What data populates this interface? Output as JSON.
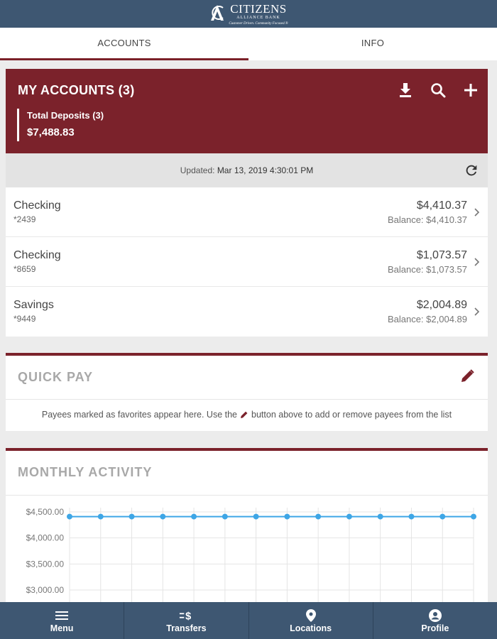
{
  "header": {
    "brand_name": "CITIZENS",
    "brand_sub": "ALLIANCE BANK",
    "brand_tagline": "Customer Driven. Community Focused.®"
  },
  "tabs": [
    {
      "label": "ACCOUNTS",
      "active": true
    },
    {
      "label": "INFO",
      "active": false
    }
  ],
  "accounts_panel": {
    "title": "MY ACCOUNTS (3)",
    "icons": [
      "download-icon",
      "search-icon",
      "add-icon"
    ],
    "total_label": "Total Deposits (3)",
    "total_value": "$7,488.83",
    "updated_prefix": "Updated:",
    "updated_value": "Mar 13, 2019 4:30:01 PM",
    "accounts": [
      {
        "name": "Checking",
        "number": "*2439",
        "amount": "$4,410.37",
        "balance": "Balance: $4,410.37"
      },
      {
        "name": "Checking",
        "number": "*8659",
        "amount": "$1,073.57",
        "balance": "Balance: $1,073.57"
      },
      {
        "name": "Savings",
        "number": "*9449",
        "amount": "$2,004.89",
        "balance": "Balance: $2,004.89"
      }
    ]
  },
  "quick_pay": {
    "title": "QUICK PAY",
    "note_before": "Payees marked as favorites appear here. Use the",
    "note_after": "button above to add or remove payees from the list"
  },
  "monthly_activity": {
    "title": "MONTHLY ACTIVITY"
  },
  "chart_data": {
    "type": "line",
    "y_ticks": [
      "$4,500.00",
      "$4,000.00",
      "$3,500.00",
      "$3,000.00"
    ],
    "y_tick_values": [
      4500,
      4000,
      3500,
      3000
    ],
    "series": [
      {
        "values": [
          4410,
          4410,
          4410,
          4410,
          4410,
          4410,
          4410,
          4410,
          4410,
          4410,
          4410,
          4410,
          4410,
          4410
        ]
      }
    ],
    "line_color": "#3ea6e6",
    "grid": true
  },
  "bottom_nav": [
    {
      "label": "Menu",
      "icon": "menu-icon"
    },
    {
      "label": "Transfers",
      "icon": "transfers-icon"
    },
    {
      "label": "Locations",
      "icon": "location-pin-icon"
    },
    {
      "label": "Profile",
      "icon": "profile-icon"
    }
  ],
  "colors": {
    "brand_navy": "#3e5772",
    "brand_maroon": "#7b222b",
    "chart_line": "#3ea6e6"
  }
}
